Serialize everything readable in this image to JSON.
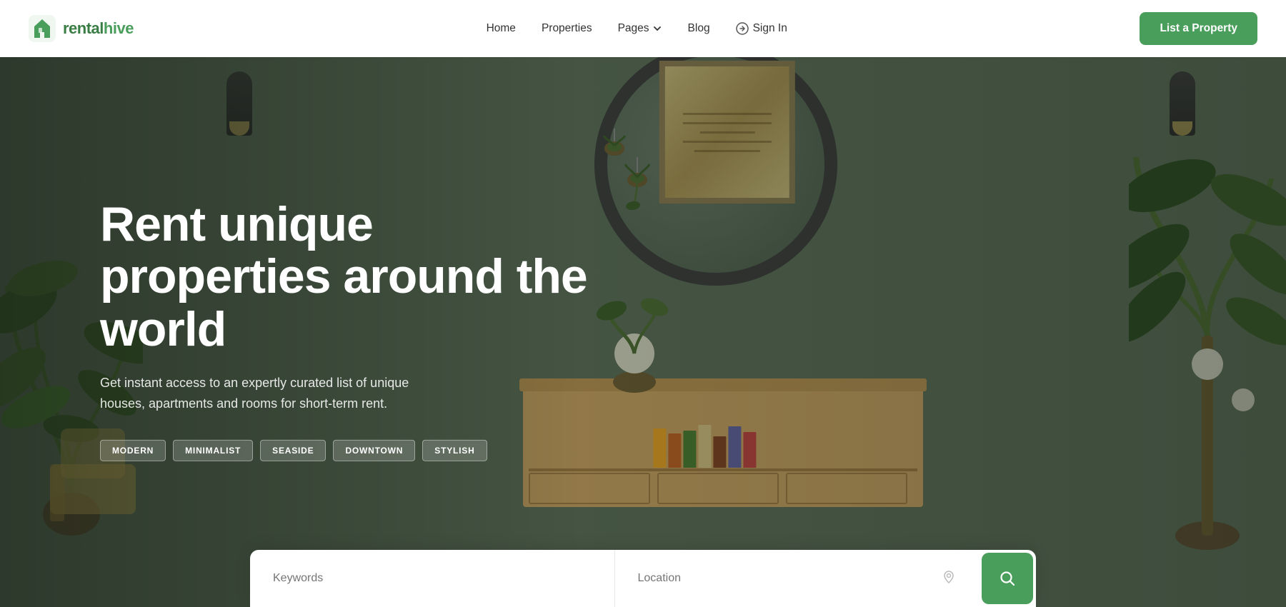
{
  "brand": {
    "name_part1": "rental",
    "name_part2": "hive"
  },
  "navbar": {
    "links": [
      {
        "id": "home",
        "label": "Home"
      },
      {
        "id": "properties",
        "label": "Properties"
      },
      {
        "id": "pages",
        "label": "Pages",
        "has_dropdown": true
      },
      {
        "id": "blog",
        "label": "Blog"
      }
    ],
    "signin_label": "Sign In",
    "list_property_label": "List a Property"
  },
  "hero": {
    "title": "Rent unique properties around the world",
    "subtitle": "Get instant access to an expertly curated list of unique houses, apartments and rooms for short-term rent.",
    "tags": [
      {
        "id": "modern",
        "label": "MODERN"
      },
      {
        "id": "minimalist",
        "label": "MINIMALIST"
      },
      {
        "id": "seaside",
        "label": "SEASIDE"
      },
      {
        "id": "downtown",
        "label": "DOWNTOWN"
      },
      {
        "id": "stylish",
        "label": "STYLISH"
      }
    ]
  },
  "search": {
    "keywords_placeholder": "Keywords",
    "location_placeholder": "Location"
  },
  "colors": {
    "primary": "#4a9e5c",
    "primary_dark": "#3a7d44",
    "text_dark": "#1a1a2e",
    "tag_bg": "rgba(255,255,255,0.18)",
    "tag_border": "rgba(255,255,255,0.4)"
  }
}
